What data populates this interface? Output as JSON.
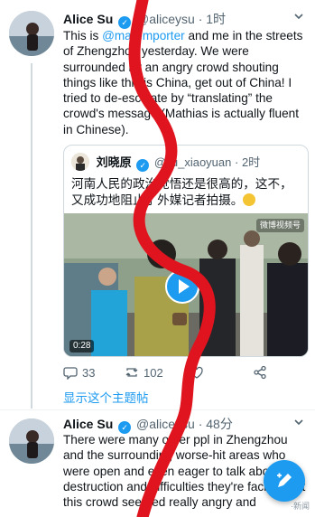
{
  "tweets": [
    {
      "author": "Alice Su",
      "handle": "@aliceysu",
      "time": "· 1时",
      "text_pre": "This is ",
      "mention": "@maremporter",
      "text_post": " and me in the streets of Zhengzhou yesterday. We were surrounded by an angry crowd shouting things like this is China, get out of China! I tried to de-escalate by “translating” the crowd's message (Mathias is actually fluent in Chinese).",
      "quote": {
        "author": "刘晓原",
        "handle": "@liu_xiaoyuan",
        "time": "· 2时",
        "text": "河南人民的政治觉悟还是很高的，这不，又成功地阻止了外媒记者拍摄。",
        "video_duration": "0:28",
        "video_watermark": "微博视频号"
      },
      "actions": {
        "replies": "33",
        "retweets": "102",
        "likes": ""
      },
      "show_thread": "显示这个主题帖"
    },
    {
      "author": "Alice Su",
      "handle": "@aliceysu",
      "time": "· 48分",
      "text": "There were many other ppl in Zhengzhou and the surrounding worse-hit areas who were open and even eager to talk about the destruction and difficulties they're facing. But this crowd seemed really angry and"
    }
  ],
  "corner_watermark": "·新闻",
  "icons": [
    "more-icon",
    "verified-icon",
    "reply-icon",
    "retweet-icon",
    "like-icon",
    "share-icon",
    "play-icon",
    "compose-icon"
  ],
  "colors": {
    "accent": "#1d9bf0",
    "scribble": "#e0141e",
    "text": "#0f1419",
    "muted": "#536471"
  }
}
